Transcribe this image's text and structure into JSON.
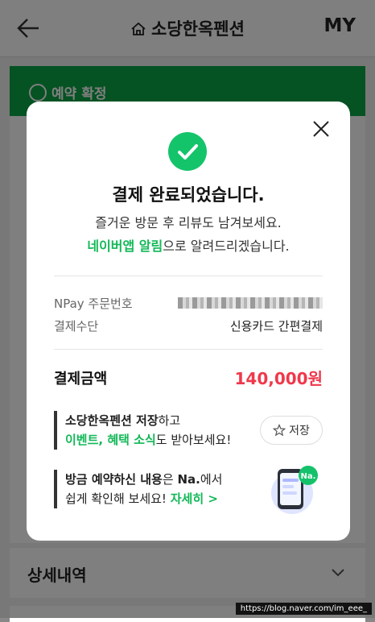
{
  "header": {
    "title": "소당한옥펜션",
    "my_label": "MY"
  },
  "banner": {
    "label": "예약 확정"
  },
  "detail": {
    "label": "상세내역"
  },
  "modal": {
    "heading": "결제 완료되었습니다.",
    "sub_line1": "즐거운 방문 후 리뷰도 남겨보세요.",
    "sub_line2_highlight": "네이버앱 알림",
    "sub_line2_rest": "으로 알려드리겠습니다.",
    "order_label": "NPay 주문번호",
    "method_label": "결제수단",
    "method_value": "신용카드 간편결제",
    "amount_label": "결제금액",
    "amount_value": "140,000원",
    "promo1_bold": "소당한옥펜션 저장",
    "promo1_rest": "하고",
    "promo1_line2_highlight": "이벤트, 혜택 소식",
    "promo1_line2_rest": "도 받아보세요!",
    "save_label": "저장",
    "promo2_bold": "방금 예약하신 내용",
    "promo2_mid": "은 ",
    "promo2_bold2": "Na.",
    "promo2_rest": "에서",
    "promo2_line2": "쉽게 확인해 보세요! ",
    "promo2_more": "자세히 >",
    "badge_text": "Na."
  },
  "watermark": "https://blog.naver.com/im_eee_",
  "colors": {
    "green": "#12b857",
    "banner_green": "#0aa545",
    "price_red": "#f0384b"
  }
}
